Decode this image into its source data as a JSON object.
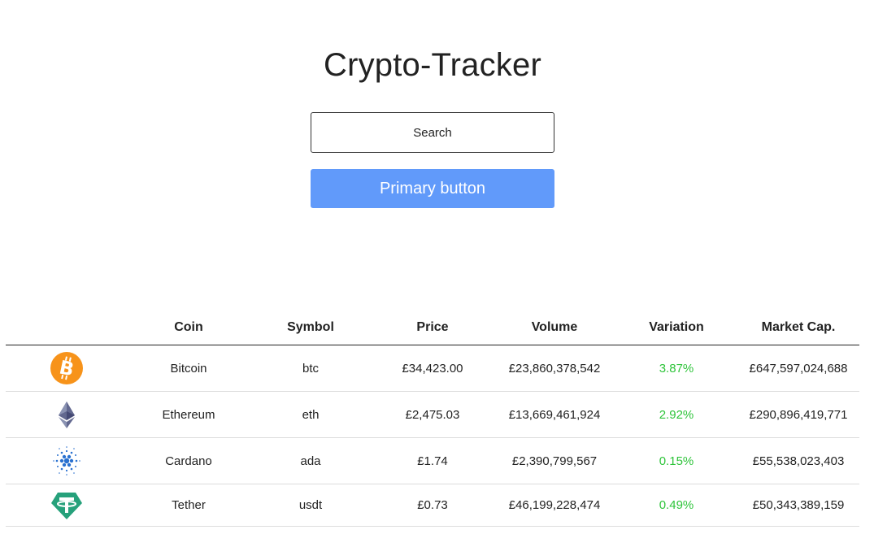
{
  "app": {
    "title": "Crypto-Tracker"
  },
  "search": {
    "placeholder": "Search"
  },
  "primary_button": {
    "label": "Primary button"
  },
  "table": {
    "headers": [
      "",
      "Coin",
      "Symbol",
      "Price",
      "Volume",
      "Variation",
      "Market Cap."
    ],
    "rows": [
      {
        "icon": "bitcoin-icon",
        "name": "Bitcoin",
        "symbol": "btc",
        "price": "£34,423.00",
        "volume": "£23,860,378,542",
        "variation": "3.87%",
        "market_cap": "£647,597,024,688"
      },
      {
        "icon": "ethereum-icon",
        "name": "Ethereum",
        "symbol": "eth",
        "price": "£2,475.03",
        "volume": "£13,669,461,924",
        "variation": "2.92%",
        "market_cap": "£290,896,419,771"
      },
      {
        "icon": "cardano-icon",
        "name": "Cardano",
        "symbol": "ada",
        "price": "£1.74",
        "volume": "£2,390,799,567",
        "variation": "0.15%",
        "market_cap": "£55,538,023,403"
      },
      {
        "icon": "tether-icon",
        "name": "Tether",
        "symbol": "usdt",
        "price": "£0.73",
        "volume": "£46,199,228,474",
        "variation": "0.49%",
        "market_cap": "£50,343,389,159"
      }
    ]
  },
  "colors": {
    "primary": "#619afa",
    "positive": "#2ec43a",
    "bitcoin": "#f7931a",
    "tether": "#26a17b",
    "cardano": "#2a71d0",
    "ethereum": "#62688f"
  }
}
